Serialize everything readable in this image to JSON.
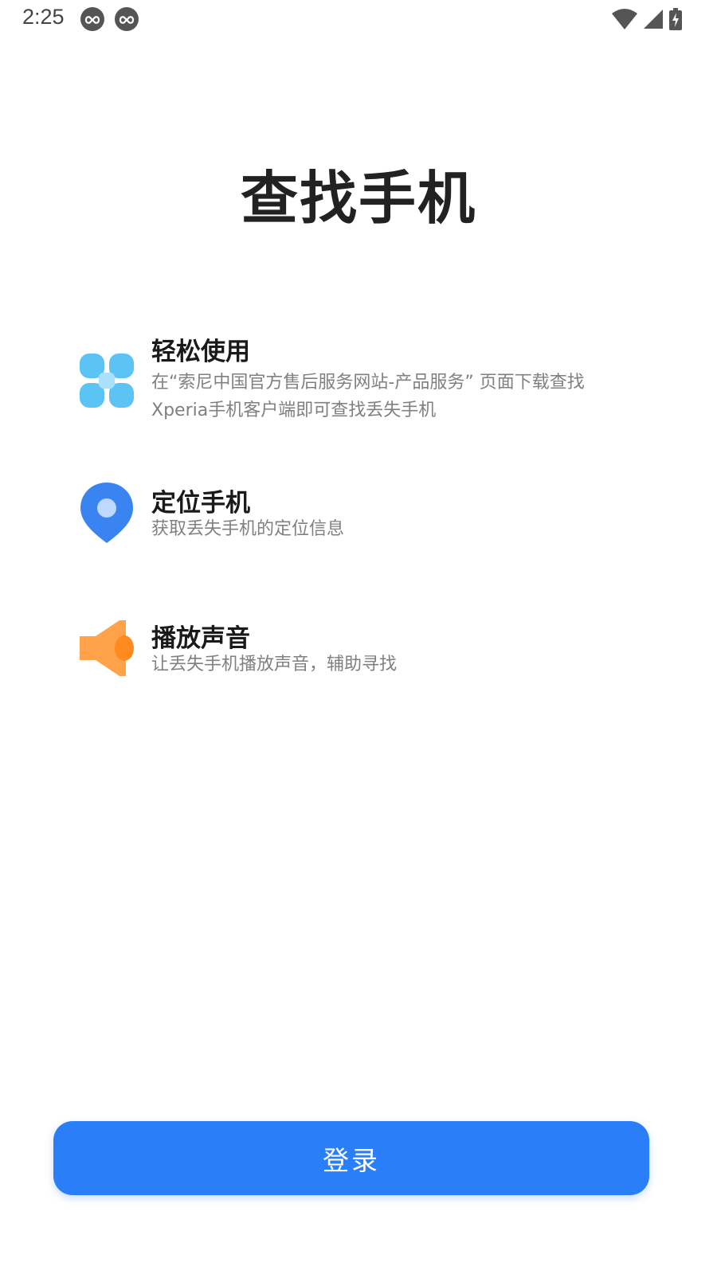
{
  "status_bar": {
    "time": "2:25",
    "notification_icons": [
      "infinity-badge-icon",
      "infinity-badge-icon"
    ],
    "right_icons": [
      "wifi-icon",
      "cell-signal-icon",
      "battery-charging-icon"
    ]
  },
  "page": {
    "title": "查找手机"
  },
  "features": [
    {
      "icon": "clover-icon",
      "title": "轻松使用",
      "description": "在“索尼中国官方售后服务网站-产品服务” 页面下载查找Xperia手机客户端即可查找丢失手机"
    },
    {
      "icon": "location-pin-icon",
      "title": "定位手机",
      "description": "获取丢失手机的定位信息"
    },
    {
      "icon": "speaker-icon",
      "title": "播放声音",
      "description": "让丢失手机播放声音，辅助寻找"
    }
  ],
  "login_button": {
    "label": "登录"
  },
  "colors": {
    "primary": "#2a7ff8",
    "clover": "#5cc4f5",
    "pin": "#3a84f2",
    "speaker": "#ffa24a"
  }
}
